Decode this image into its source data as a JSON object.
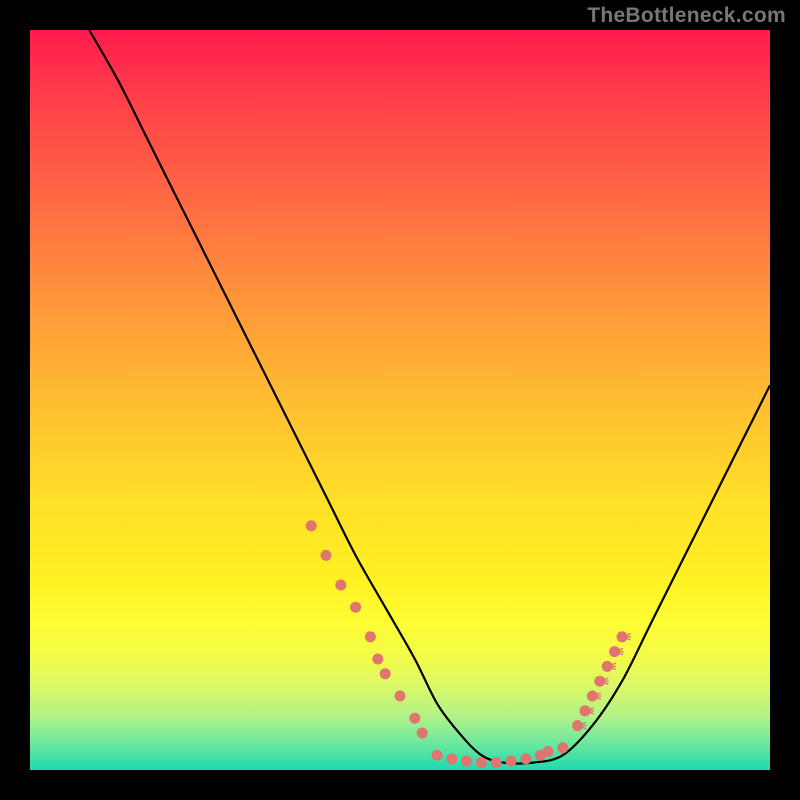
{
  "watermark": "TheBottleneck.com",
  "colors": {
    "frame": "#000000",
    "curve": "#000000",
    "dot": "#e0746e"
  },
  "chart_data": {
    "type": "line",
    "title": "",
    "xlabel": "",
    "ylabel": "",
    "xlim": [
      0,
      100
    ],
    "ylim": [
      0,
      100
    ],
    "grid": false,
    "legend": false,
    "series": [
      {
        "name": "bottleneck-curve",
        "x": [
          8,
          12,
          16,
          20,
          24,
          28,
          32,
          36,
          40,
          44,
          48,
          52,
          55,
          58,
          61,
          64,
          68,
          72,
          76,
          80,
          84,
          88,
          92,
          96,
          100
        ],
        "y": [
          100,
          93,
          85,
          77,
          69,
          61,
          53,
          45,
          37,
          29,
          22,
          15,
          9,
          5,
          2,
          1,
          1,
          2,
          6,
          12,
          20,
          28,
          36,
          44,
          52
        ]
      }
    ],
    "marker_clusters": [
      {
        "name": "left-descent-dots",
        "x": [
          38,
          40,
          42,
          44,
          46,
          47,
          48,
          50,
          52,
          53
        ],
        "y": [
          33,
          29,
          25,
          22,
          18,
          15,
          13,
          10,
          7,
          5
        ]
      },
      {
        "name": "valley-floor-dots",
        "x": [
          55,
          57,
          59,
          61,
          63,
          65,
          67,
          69,
          70,
          72
        ],
        "y": [
          2,
          1.5,
          1.2,
          1,
          1,
          1.2,
          1.5,
          2,
          2.5,
          3
        ]
      },
      {
        "name": "right-ascent-dots",
        "x": [
          74,
          75,
          76,
          77,
          78,
          79,
          80
        ],
        "y": [
          6,
          8,
          10,
          12,
          14,
          16,
          18
        ]
      }
    ]
  }
}
